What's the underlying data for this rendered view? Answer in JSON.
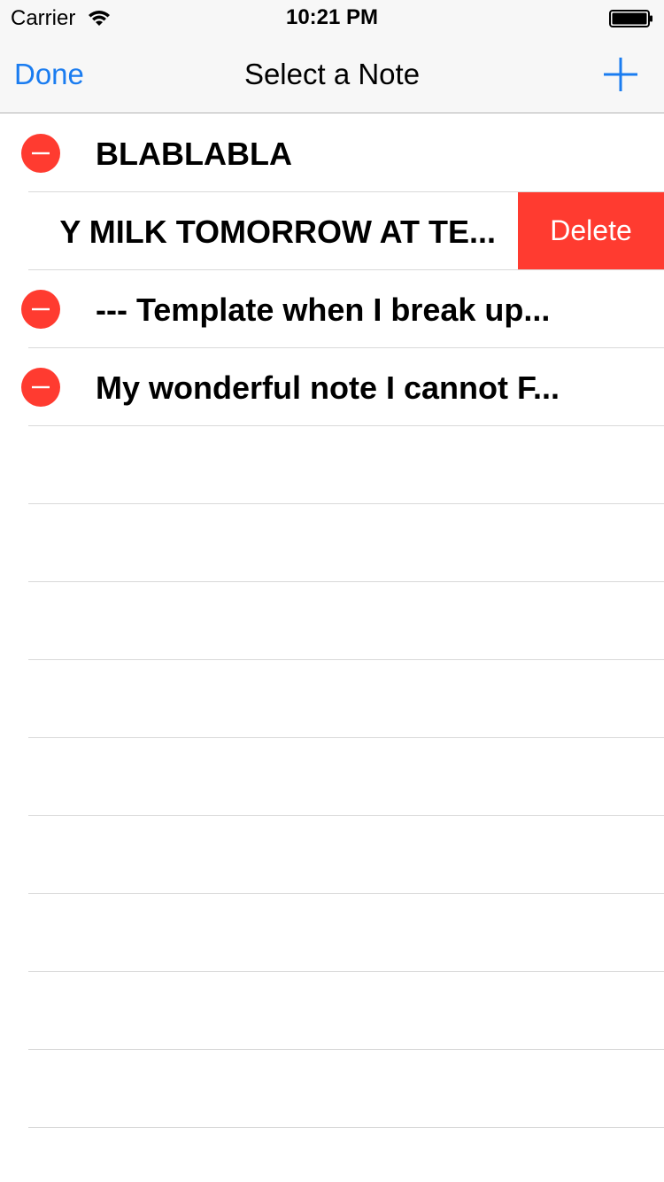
{
  "status_bar": {
    "carrier": "Carrier",
    "time": "10:21 PM",
    "wifi_icon": "wifi-icon",
    "battery_icon": "battery-icon"
  },
  "nav": {
    "done_label": "Done",
    "title": "Select a Note",
    "add_icon": "plus-icon",
    "accent_color": "#1a7cf0"
  },
  "notes": [
    {
      "title": "BLABLABLA"
    },
    {
      "title": "Y MILK TOMORROW AT TE...",
      "swiped": true,
      "delete_label": "Delete"
    },
    {
      "title": "--- Template when I break up..."
    },
    {
      "title": "My wonderful note I cannot F..."
    }
  ],
  "colors": {
    "delete": "#ff3b30",
    "separator": "#d9d9d9"
  }
}
